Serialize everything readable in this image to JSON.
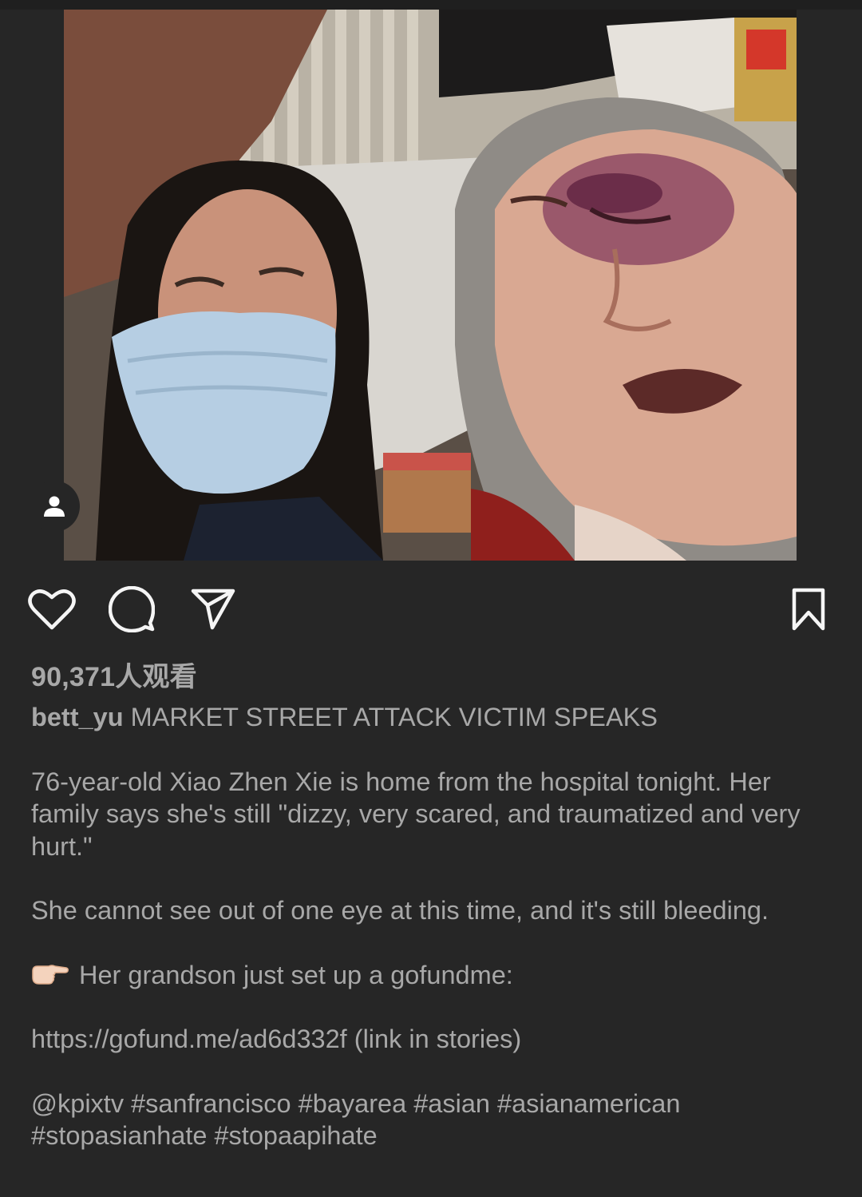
{
  "post": {
    "views_count": "90,371",
    "views_suffix": "人观看",
    "username": "bett_yu",
    "headline": "MARKET STREET ATTACK VICTIM SPEAKS",
    "paragraphs": [
      "76-year-old Xiao Zhen Xie is home from the hospital tonight. Her family says she's still \"dizzy, very scared, and traumatized and very hurt.\"",
      "She cannot see out of one eye at this time, and it's still bleeding."
    ],
    "gofundme_line": "Her grandson just set up a gofundme:",
    "pointer_icon": "backhand-index-pointing-right-emoji",
    "link_line": "https://gofund.me/ad6d332f (link in stories)",
    "tags_line_1": "@kpixtv #sanfrancisco #bayarea #asian #asianamerican",
    "tags_line_2": "#stopasianhate #stopaapihate"
  },
  "icons": {
    "like": "heart-outline-icon",
    "comment": "comment-bubble-icon",
    "share": "paper-plane-icon",
    "save": "bookmark-icon",
    "user_tag": "person-icon"
  },
  "colors": {
    "background": "#262626",
    "text": "#a8a8a8",
    "icon": "#f5f5f5"
  }
}
